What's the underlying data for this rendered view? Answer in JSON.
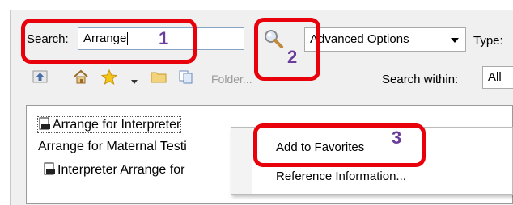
{
  "search": {
    "label": "Search:",
    "value": "Arrange"
  },
  "advanced_options": {
    "label": "Advanced Options"
  },
  "type_label": "Type:",
  "toolbar": {
    "folder_label": "Folder..."
  },
  "search_within": {
    "label": "Search within:",
    "value": "All"
  },
  "results": [
    {
      "label": "Arrange for Interpreter",
      "has_icon": true
    },
    {
      "label": "Arrange for Maternal Testi",
      "has_icon": false
    },
    {
      "label": "Interpreter Arrange for",
      "has_icon": true
    }
  ],
  "context_menu": {
    "items": [
      "Add to Favorites",
      "Reference Information..."
    ]
  },
  "step_numbers": [
    "1",
    "2",
    "3"
  ],
  "colors": {
    "highlight": "#e8000b",
    "step_number": "#6a3d9a"
  }
}
